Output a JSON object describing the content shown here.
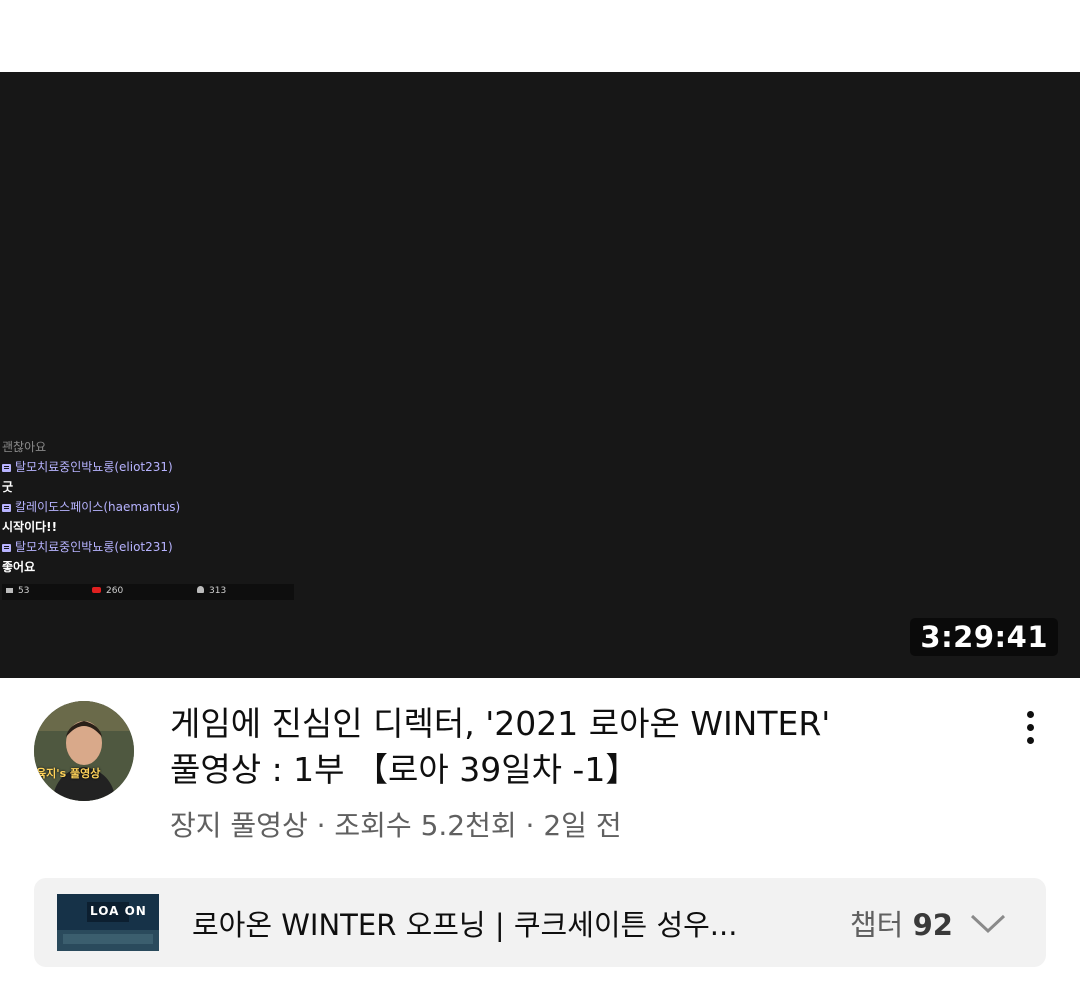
{
  "player": {
    "duration": "3:29:41",
    "chat": {
      "lines": [
        {
          "kind": "msg-faded",
          "text": "괜찮아요"
        },
        {
          "kind": "user",
          "text": "탈모치료중인박뇨롱(eliot231)"
        },
        {
          "kind": "msg",
          "text": "굿"
        },
        {
          "kind": "user",
          "text": "칼레이도스페이스(haemantus)"
        },
        {
          "kind": "msg",
          "text": "시작이다!!"
        },
        {
          "kind": "user",
          "text": "탈모치료중인박뇨롱(eliot231)"
        },
        {
          "kind": "msg",
          "text": "좋어요"
        }
      ],
      "stats": {
        "chats": "53",
        "youtube": "260",
        "viewers": "313"
      }
    }
  },
  "video": {
    "title_line1": "게임에 진심인 디렉터, '2021 로아온 WINTER'",
    "title_line2": "풀영상 : 1부 【로아 39일차 -1】",
    "channel": "장지 풀영상",
    "separator": " · ",
    "views": "조회수 5.2천회",
    "age": "2일 전",
    "avatar_text": "육지's 풀영상",
    "more_icon": "more-vert-icon"
  },
  "chapter": {
    "title": "로아온 WINTER 오프닝 | 쿠크세이튼 성우...",
    "label": "챕터",
    "count": "92",
    "thumb_text": "LOA ON",
    "chevron_icon": "chevron-down-icon"
  }
}
